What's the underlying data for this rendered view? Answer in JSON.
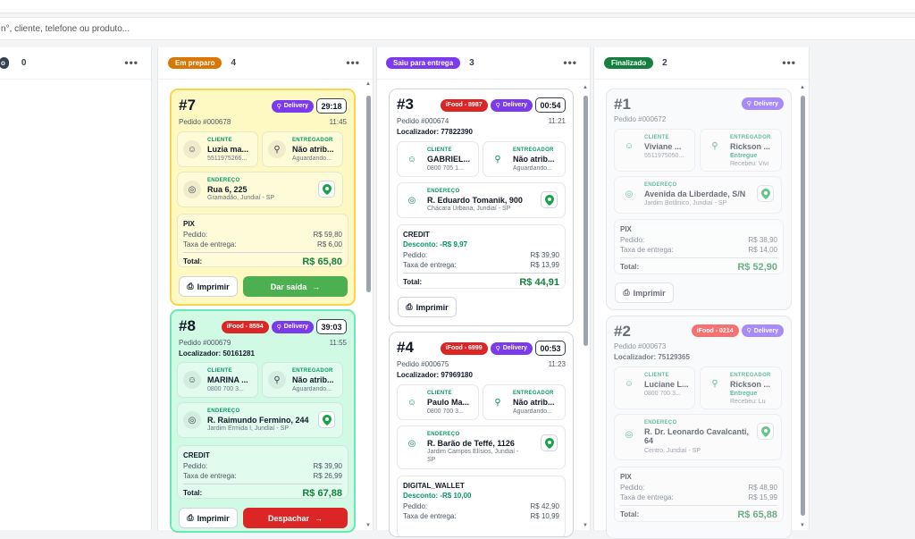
{
  "search": {
    "placeholder": "n°, cliente, telefone ou produto..."
  },
  "columns": [
    {
      "label": "o",
      "count": "0",
      "color": "#374151"
    },
    {
      "label": "Em preparo",
      "count": "4",
      "color": "#d97706"
    },
    {
      "label": "Saiu para entrega",
      "count": "3",
      "color": "#7c3aed"
    },
    {
      "label": "Finalizado",
      "count": "2",
      "color": "#15803d"
    }
  ],
  "col_menu": "•••",
  "labels": {
    "cliente": "CLIENTE",
    "entregador": "ENTREGADOR",
    "endereco": "ENDEREÇO",
    "pedido": "Pedido:",
    "taxa": "Taxa de entrega:",
    "total": "Total:",
    "imprimir": "Imprimir",
    "delivery": "Delivery"
  },
  "orders": {
    "o7": {
      "num": "#7",
      "timer": "29:18",
      "pedido": "Pedido #000678",
      "time": "11:45",
      "cliente": "Luzia ma...",
      "cliente_sub": "5511975266...",
      "entregador": "Não atrib...",
      "entregador_sub": "Aguardando...",
      "addr": "Rua 6, 225",
      "addr_sub": "Gramadão, Jundiaí - SP",
      "payment": "PIX",
      "pedido_val": "R$ 59,80",
      "taxa_val": "R$ 6,00",
      "total": "R$ 65,80",
      "action": "Dar saída"
    },
    "o8": {
      "num": "#8",
      "ifood": "iFood - 8554",
      "timer": "39:03",
      "pedido": "Pedido #000679",
      "time": "11:55",
      "loc": "Localizador: 50161281",
      "cliente": "MARINA ...",
      "cliente_sub": "0800 700 3...",
      "entregador": "Não atrib...",
      "entregador_sub": "Aguardando...",
      "addr": "R. Raimundo Fermino, 244",
      "addr_sub": "Jardim Ermida I, Jundiaí - SP",
      "payment": "CREDIT",
      "pedido_val": "R$ 39,90",
      "taxa_val": "R$ 26,99",
      "total": "R$ 67,88",
      "action": "Despachar"
    },
    "o3": {
      "num": "#3",
      "ifood": "iFood - 8987",
      "timer": "00:54",
      "pedido": "Pedido #000674",
      "time": "11:21",
      "loc": "Localizador: 77822390",
      "cliente": "GABRIEL...",
      "cliente_sub": "0800 705 1...",
      "entregador": "Não atrib...",
      "entregador_sub": "Aguardando...",
      "addr": "R. Eduardo Tomanik, 900",
      "addr_sub": "Chácara Urbana, Jundiaí - SP",
      "payment": "CREDIT",
      "discount": "Desconto: -R$ 9,97",
      "pedido_val": "R$ 39,90",
      "taxa_val": "R$ 13,99",
      "total": "R$ 44,91"
    },
    "o4": {
      "num": "#4",
      "ifood": "iFood - 6999",
      "timer": "00:53",
      "pedido": "Pedido #000675",
      "time": "11:23",
      "loc": "Localizador: 97969180",
      "cliente": "Paulo Ma...",
      "cliente_sub": "0800 700 3...",
      "entregador": "Não atrib...",
      "entregador_sub": "Aguardando...",
      "addr": "R. Barão de Teffé, 1126",
      "addr_sub1": "Jardim Campos Elísios, Jundiaí -",
      "addr_sub2": "SP",
      "payment": "DIGITAL_WALLET",
      "discount": "Desconto: -R$ 10,00",
      "pedido_val": "R$ 42,90",
      "taxa_val": "R$ 10,99"
    },
    "o1": {
      "num": "#1",
      "pedido": "Pedido #000672",
      "cliente": "Viviane ...",
      "cliente_sub": "5511975050...",
      "entregador": "Rickson ...",
      "entregador_status": "Entregue",
      "entregador_sub": "Recebeu: Vivi",
      "addr": "Avenida da Liberdade, S/N",
      "addr_sub": "Jardim Botânico, Jundiaí - SP",
      "payment": "PIX",
      "pedido_val": "R$ 38,90",
      "taxa_val": "R$ 14,00",
      "total": "R$ 52,90"
    },
    "o2": {
      "num": "#2",
      "ifood": "iFood - 0214",
      "pedido": "Pedido #000673",
      "loc": "Localizador: 75129365",
      "cliente": "Luciane L...",
      "cliente_sub": "0800 700 3...",
      "entregador": "Rickson ...",
      "entregador_status": "Entregue",
      "entregador_sub": "Recebeu: Lu",
      "addr1": "R. Dr. Leonardo Cavalcanti,",
      "addr2": "64",
      "addr_sub": "Centro, Jundiaí - SP",
      "payment": "PIX",
      "pedido_val": "R$ 48,90",
      "taxa_val": "R$ 15,99",
      "total": "R$ 65,88"
    }
  },
  "colors": {
    "green_btn": "#4caf50",
    "red_btn": "#dc2626",
    "accent_green": "#059669"
  }
}
